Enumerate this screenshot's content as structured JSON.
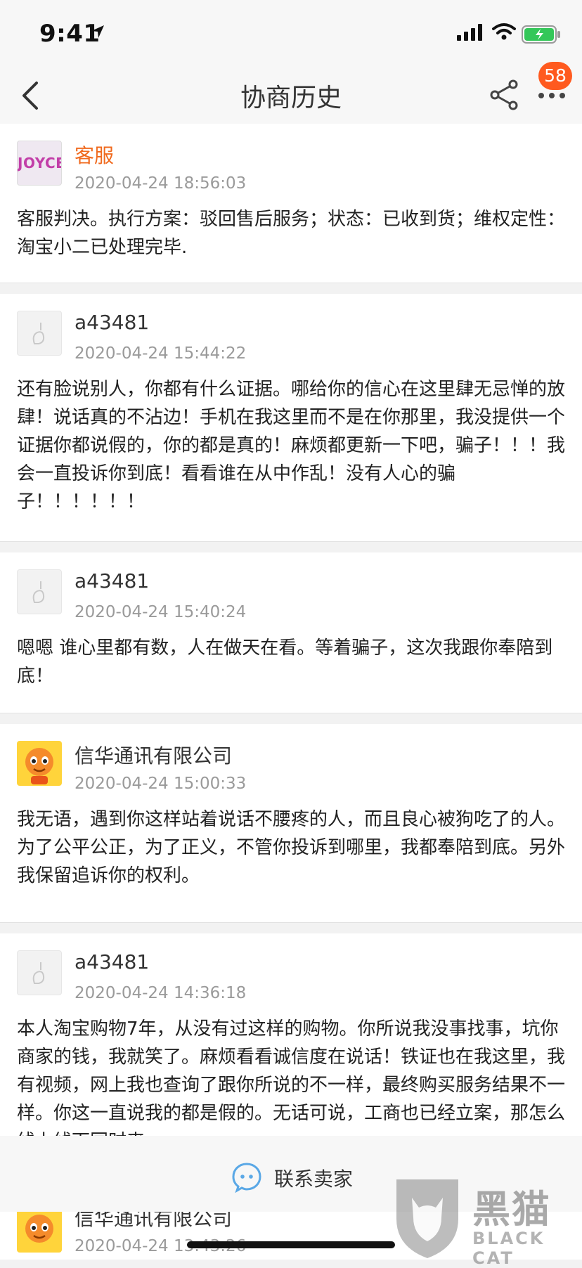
{
  "status_bar": {
    "time": "9:41"
  },
  "nav": {
    "title": "协商历史",
    "badge_count": "58"
  },
  "messages": [
    {
      "name": "客服",
      "avatar": "JOYCE",
      "date": "2020-04-24 18:56:03",
      "text": "客服判决。执行方案：驳回售后服务；状态：已收到货；维权定性：淘宝小二已处理完毕."
    },
    {
      "name": "a43481",
      "date": "2020-04-24 15:44:22",
      "text": "还有脸说别人，你都有什么证据。哪给你的信心在这里肆无忌惮的放肆！说话真的不沾边！手机在我这里而不是在你那里，我没提供一个证据你都说假的，你的都是真的！麻烦都更新一下吧，骗子！！！我会一直投诉你到底！看看谁在从中作乱！没有人心的骗子！！！！！！"
    },
    {
      "name": "a43481",
      "date": "2020-04-24 15:40:24",
      "text": "嗯嗯  谁心里都有数，人在做天在看。等着骗子，这次我跟你奉陪到底！"
    },
    {
      "name": "信华通讯有限公司",
      "date": "2020-04-24 15:00:33",
      "text": "我无语，遇到你这样站着说话不腰疼的人，而且良心被狗吃了的人。为了公平公正，为了正义，不管你投诉到哪里，我都奉陪到底。另外我保留追诉你的权利。"
    },
    {
      "name": "a43481",
      "date": "2020-04-24 14:36:18",
      "text": "本人淘宝购物7年，从没有过这样的购物。你所说我没事找事，坑你商家的钱，我就笑了。麻烦看看诚信度在说话！铁证也在我这里，我有视频，网上我也查询了跟你所说的不一样，最终购买服务结果不一样。你这一直说我的都是假的。无话可说，工商也已经立案，那怎么线上线下同时来"
    }
  ],
  "peek": {
    "name": "信华通讯有限公司",
    "date": "2020-04-24 13:43:26"
  },
  "bottom": {
    "contact_label": "联系卖家"
  },
  "watermark": {
    "cn": "黑猫",
    "en": "BLACK CAT"
  },
  "icons": [
    "back-chevron-icon",
    "share-icon",
    "more-dots-icon",
    "contact-chat-icon",
    "location-arrow-icon",
    "signal-icon",
    "wifi-icon",
    "battery-icon"
  ],
  "colors": {
    "accent": "#ff5a1f",
    "service_name": "#f06a1e",
    "date": "#9a9a9a"
  }
}
